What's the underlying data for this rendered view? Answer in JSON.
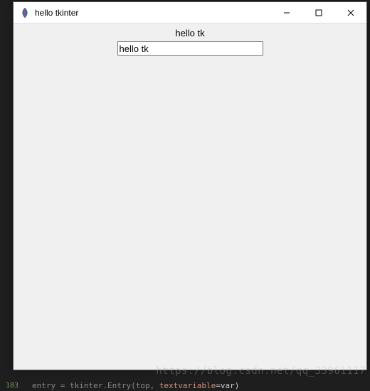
{
  "window": {
    "title": "hello tkinter",
    "icon_name": "tk-feather-icon"
  },
  "titlebar_controls": {
    "minimize": "—",
    "maximize": "☐",
    "close": "✕"
  },
  "content": {
    "label_text": "hello tk",
    "entry_value": "hello tk"
  },
  "watermark": "https://blog.csdn.net/qq_33961117",
  "editor": {
    "line_number": "183",
    "code_prefix": "entry = tkinter.Entry(top, ",
    "code_kw": "textvariable",
    "code_suffix": "=var)"
  }
}
